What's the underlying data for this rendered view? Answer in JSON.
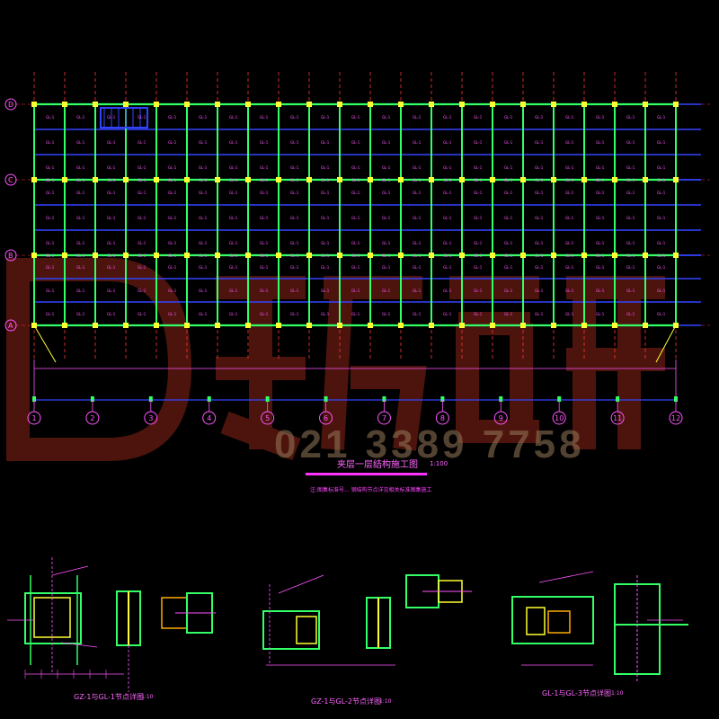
{
  "plan": {
    "title": "夹层一层结构施工图",
    "scale": "1:100",
    "note": "注:图集标准号... 钢结构节点详见相关标准图集施工",
    "column_axes": [
      "1",
      "2",
      "3",
      "4",
      "5",
      "6",
      "7",
      "8",
      "9",
      "10",
      "11",
      "12"
    ],
    "row_axes": [
      "A",
      "B",
      "C",
      "D"
    ],
    "member_tag": "GL-1"
  },
  "details": [
    {
      "title": "GZ-1与GL-1节点详图",
      "scale": "1:10"
    },
    {
      "title": "GZ-1与GL-2节点详图",
      "scale": "1:10"
    },
    {
      "title": "GL-1与GL-3节点详图",
      "scale": "1:10"
    }
  ],
  "watermark": {
    "text": "021 3389 7758"
  },
  "colors": {
    "background": "#000000",
    "beam": "#33ff66",
    "grid": "#3344ff",
    "axis": "#ff3333",
    "annotation": "#ff44ff",
    "column": "#ffff33",
    "bracket": "#ffaa00"
  }
}
